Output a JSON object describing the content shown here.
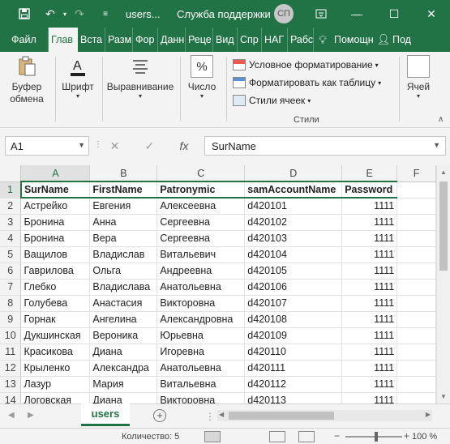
{
  "title_bar": {
    "save_icon": "save-icon",
    "undo_icon": "undo-icon",
    "redo_icon": "redo-icon",
    "customize_icon": "customize-qat-icon",
    "file_name": "users...",
    "app_name": "Служба поддержки",
    "user_initials": "СП",
    "window_buttons": [
      "ribbon-display-icon",
      "minimize-icon",
      "maximize-icon",
      "close-icon"
    ]
  },
  "ribbon_tabs": [
    "Файл",
    "Глав",
    "Вста",
    "Разм",
    "Фор",
    "Данн",
    "Реце",
    "Вид",
    "Спр",
    "НАГ",
    "Рабс"
  ],
  "ribbon_tab_active": "Глав",
  "tell_me": "Помощн",
  "share": "Под",
  "ribbon_groups": {
    "clipboard": "Буфер обмена",
    "font": "Шрифт",
    "alignment": "Выравнивание",
    "number": "Число",
    "styles_items": [
      "Условное форматирование",
      "Форматировать как таблицу",
      "Стили ячеек"
    ],
    "styles_label": "Стили",
    "cells": "Ячей"
  },
  "formula_bar": {
    "name_box": "A1",
    "fx": "fx",
    "formula": "SurName"
  },
  "columns": [
    "A",
    "B",
    "C",
    "D",
    "E",
    "F"
  ],
  "header_row": [
    "SurName",
    "FirstName",
    "Patronymic",
    "samAccountName",
    "Password"
  ],
  "rows": [
    [
      "1",
      "",
      "",
      "",
      "",
      ""
    ],
    [
      "2",
      "Астрейко",
      "Евгения",
      "Алексеевна",
      "d420101",
      "1111"
    ],
    [
      "3",
      "Бронина",
      "Анна",
      "Сергеевна",
      "d420102",
      "1111"
    ],
    [
      "4",
      "Бронина",
      "Вера",
      "Сергеевна",
      "d420103",
      "1111"
    ],
    [
      "5",
      "Ващилов",
      "Владислав",
      "Витальевич",
      "d420104",
      "1111"
    ],
    [
      "6",
      "Гаврилова",
      "Ольга",
      "Андреевна",
      "d420105",
      "1111"
    ],
    [
      "7",
      "Глебко",
      "Владислава",
      "Анатольевна",
      "d420106",
      "1111"
    ],
    [
      "8",
      "Голубева",
      "Анастасия",
      "Викторовна",
      "d420107",
      "1111"
    ],
    [
      "9",
      "Горнак",
      "Ангелина",
      "Александровна",
      "d420108",
      "1111"
    ],
    [
      "10",
      "Дукшинская",
      "Вероника",
      "Юрьевна",
      "d420109",
      "1111"
    ],
    [
      "11",
      "Красикова",
      "Диана",
      "Игоревна",
      "d420110",
      "1111"
    ],
    [
      "12",
      "Крыленко",
      "Александра",
      "Анатольевна",
      "d420111",
      "1111"
    ],
    [
      "13",
      "Лазур",
      "Мария",
      "Витальевна",
      "d420112",
      "1111"
    ],
    [
      "14",
      "Логовская",
      "Диана",
      "Викторовна",
      "d420113",
      "1111"
    ]
  ],
  "sheet_tab": "users",
  "status": {
    "count": "Количество: 5",
    "zoom": "100 %",
    "zoom_minus": "−",
    "zoom_plus": "+"
  }
}
